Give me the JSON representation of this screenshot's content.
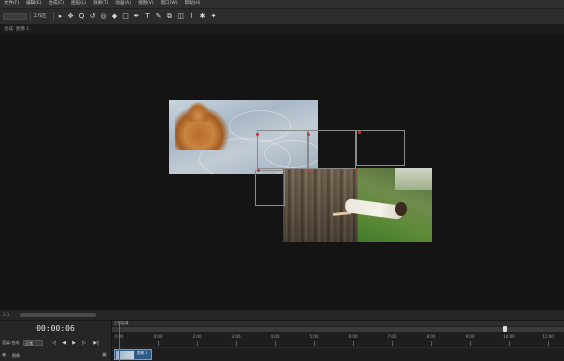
{
  "menu": {
    "items": [
      "文件(F)",
      "编辑(E)",
      "合成(C)",
      "图层(L)",
      "效果(T)",
      "动画(A)",
      "视图(V)",
      "窗口(W)",
      "帮助(H)"
    ]
  },
  "toolbar": {
    "workspace_label": "工作区",
    "icons": [
      "home-icon",
      "selection-icon",
      "hand-icon",
      "zoom-icon",
      "rotate-icon",
      "camera-orbit-icon",
      "pan-behind-icon",
      "rectangle-icon",
      "pen-icon",
      "text-icon",
      "brush-icon",
      "clone-icon",
      "eraser-icon",
      "roto-icon",
      "puppet-icon"
    ],
    "glyphs": [
      "▸",
      "✥",
      "Q",
      "↺",
      "◎",
      "◆",
      "□",
      "✒",
      "T",
      "✎",
      "⧉",
      "◫",
      "⌇",
      "✱",
      "✦"
    ]
  },
  "panel": {
    "title": "合成: 图像 1"
  },
  "timeline": {
    "scroll_label": "1:1",
    "timecode": "00:00:06",
    "render_label": "渲染:合成",
    "quality_select": "正常",
    "controls": [
      "◁",
      "◀",
      "▶",
      "▷",
      "▶|"
    ],
    "track_label": "图像",
    "work_area_label": "工作区域",
    "ruler_labels": [
      "0:00",
      "0:00",
      "2:00",
      "3:00",
      "4:00",
      "5:00",
      "6:00",
      "7:00",
      "8:00",
      "9:00",
      "10:00",
      "11:00"
    ],
    "clip_label": "图像 1",
    "playhead_time": "00:00:06"
  },
  "colors": {
    "accent": "#d0303a",
    "background": "#141414",
    "panel": "#222222",
    "clip": "#2f5b8a"
  }
}
